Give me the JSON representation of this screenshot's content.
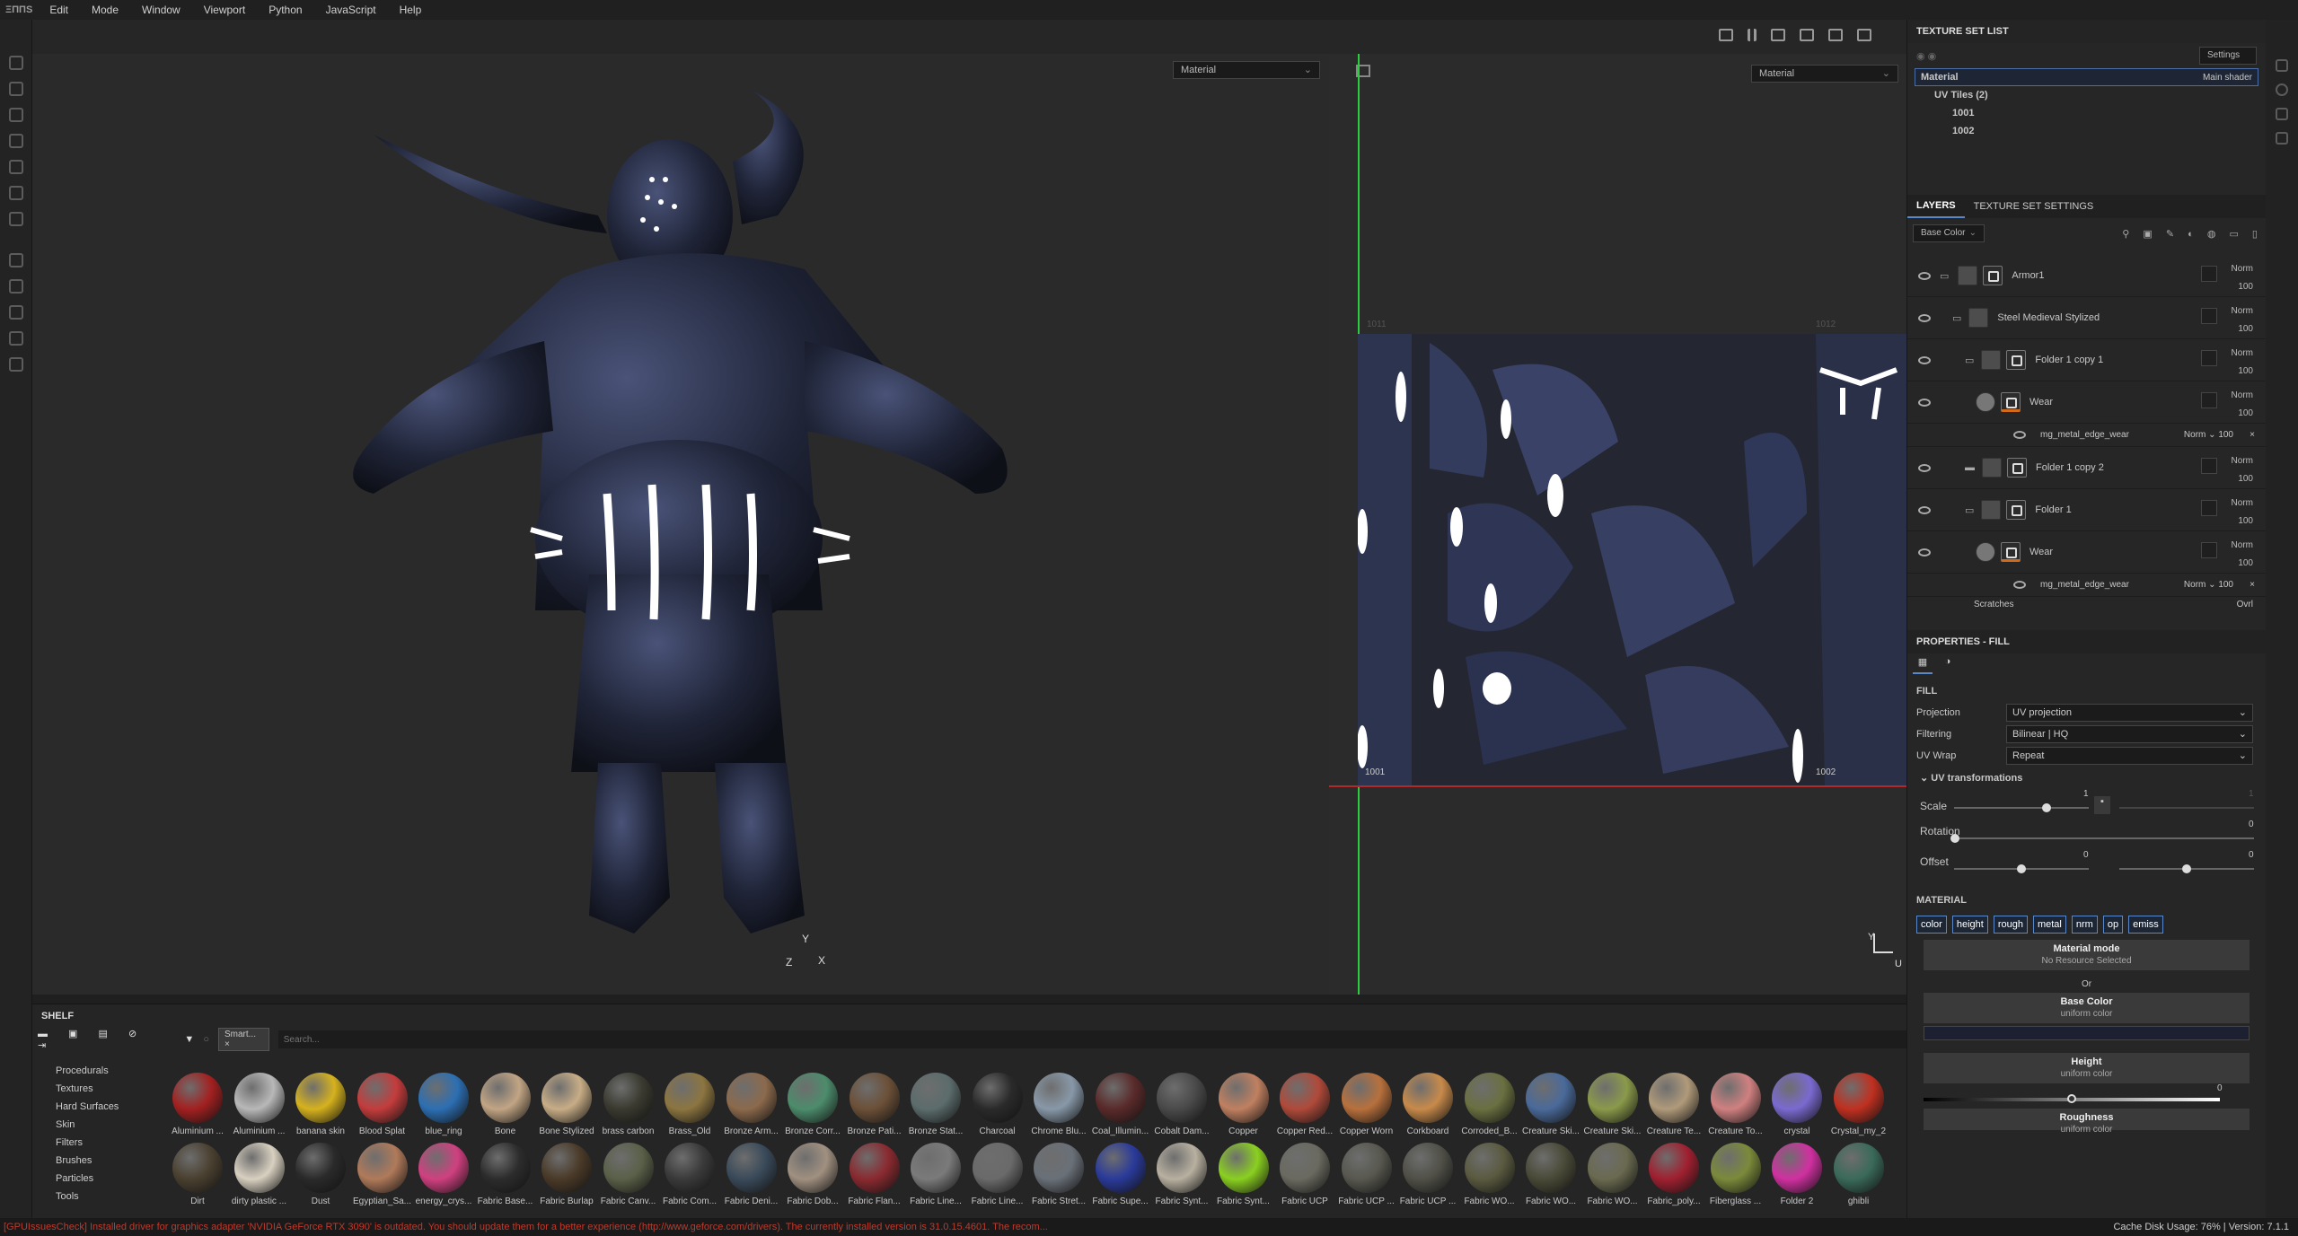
{
  "app": {
    "logo": "ΞΠΠS"
  },
  "menu": [
    "Edit",
    "Mode",
    "Window",
    "Viewport",
    "Python",
    "JavaScript",
    "Help"
  ],
  "viewport3d": {
    "channel": "Material",
    "axis_x": "X",
    "axis_y": "Y",
    "axis_z": "Z"
  },
  "viewport2d": {
    "channel": "Material",
    "tile_a": "1001",
    "tile_b": "1002",
    "axis_y": "Y",
    "axis_u": "U",
    "top_a": "1011",
    "top_b": "1012"
  },
  "texture_set_list": {
    "title": "TEXTURE SET LIST",
    "settings": "Settings",
    "material": "Material",
    "shader": "Main shader",
    "uv_tiles": "UV Tiles (2)",
    "tiles": [
      "1001",
      "1002"
    ]
  },
  "layers": {
    "tab_layers": "LAYERS",
    "tab_tss": "TEXTURE SET SETTINGS",
    "channel": "Base Color",
    "items": [
      {
        "name": "Armor1",
        "blend": "Norm",
        "opacity": "100",
        "type": "folder-open",
        "indent": 0
      },
      {
        "name": "Steel Medieval Stylized",
        "blend": "Norm",
        "opacity": "100",
        "type": "folder-open",
        "indent": 1
      },
      {
        "name": "Folder 1 copy 1",
        "blend": "Norm",
        "opacity": "100",
        "type": "folder-open",
        "indent": 2
      },
      {
        "name": "Wear",
        "blend": "Norm",
        "opacity": "100",
        "type": "fill",
        "indent": 3
      },
      {
        "name": "Folder 1 copy 2",
        "blend": "Norm",
        "opacity": "100",
        "type": "folder",
        "indent": 2
      },
      {
        "name": "Folder 1",
        "blend": "Norm",
        "opacity": "100",
        "type": "folder-open",
        "indent": 2
      },
      {
        "name": "Wear",
        "blend": "Norm",
        "opacity": "100",
        "type": "fill",
        "indent": 3
      }
    ],
    "sub_effect": "mg_metal_edge_wear",
    "sub_blend": "Norm",
    "sub_opacity": "100",
    "last_partial": "Scratches",
    "last_blend": "Ovrl"
  },
  "properties": {
    "title": "PROPERTIES - FILL",
    "section_fill": "FILL",
    "projection_label": "Projection",
    "projection": "UV projection",
    "filtering_label": "Filtering",
    "filtering": "Bilinear | HQ",
    "uvwrap_label": "UV Wrap",
    "uvwrap": "Repeat",
    "uvtrans": "UV transformations",
    "scale_label": "Scale",
    "scale_value": "1",
    "scale_value2": "1",
    "rotation_label": "Rotation",
    "rotation_value": "0",
    "offset_label": "Offset",
    "offset_a": "0",
    "offset_b": "0",
    "section_material": "MATERIAL",
    "channels": [
      "color",
      "height",
      "rough",
      "metal",
      "nrm",
      "op",
      "emiss"
    ],
    "material_mode": "Material mode",
    "no_resource": "No Resource Selected",
    "or": "Or",
    "base_color": "Base Color",
    "base_color_sub": "uniform color",
    "height": "Height",
    "height_sub": "uniform color",
    "height_value": "0",
    "roughness": "Roughness",
    "roughness_sub": "uniform color"
  },
  "shelf": {
    "title": "SHELF",
    "filter_tag": "Smart...",
    "search_placeholder": "Search...",
    "categories": [
      "Procedurals",
      "Textures",
      "Hard Surfaces",
      "Skin",
      "Filters",
      "Brushes",
      "Particles",
      "Tools"
    ],
    "row1": [
      {
        "name": "Aluminium ...",
        "color": "#a32020"
      },
      {
        "name": "Aluminium ...",
        "color": "#b8b8b8"
      },
      {
        "name": "banana skin",
        "color": "#d6b21e"
      },
      {
        "name": "Blood Splat",
        "color": "#c43c3c"
      },
      {
        "name": "blue_ring",
        "color": "#2c6fb3"
      },
      {
        "name": "Bone",
        "color": "#c2a584"
      },
      {
        "name": "Bone Stylized",
        "color": "#c8ad86"
      },
      {
        "name": "brass carbon",
        "color": "#3a3a30"
      },
      {
        "name": "Brass_Old",
        "color": "#8c7540"
      },
      {
        "name": "Bronze Arm...",
        "color": "#8c6a4c"
      },
      {
        "name": "Bronze Corr...",
        "color": "#4c8c6c"
      },
      {
        "name": "Bronze Pati...",
        "color": "#6c5038"
      },
      {
        "name": "Bronze Stat...",
        "color": "#5c6c6c"
      },
      {
        "name": "Charcoal",
        "color": "#2a2a2a"
      },
      {
        "name": "Chrome Blu...",
        "color": "#8898a8"
      },
      {
        "name": "Coal_Illumin...",
        "color": "#5a2a2a"
      },
      {
        "name": "Cobalt Dam...",
        "color": "#4a4a4a"
      },
      {
        "name": "Copper",
        "color": "#c08060"
      },
      {
        "name": "Copper Red...",
        "color": "#b04a3a"
      },
      {
        "name": "Copper Worn",
        "color": "#b8703c"
      },
      {
        "name": "Corkboard",
        "color": "#c88a4a"
      },
      {
        "name": "Corroded_B...",
        "color": "#6a7040"
      },
      {
        "name": "Creature Ski...",
        "color": "#4a6a9a"
      },
      {
        "name": "Creature Ski...",
        "color": "#8a9a4a"
      },
      {
        "name": "Creature Te...",
        "color": "#b09a7a"
      },
      {
        "name": "Creature To...",
        "color": "#d08080"
      },
      {
        "name": "crystal",
        "color": "#7a6ad0"
      },
      {
        "name": "Crystal_my_2",
        "color": "#c03020"
      }
    ],
    "row2": [
      {
        "name": "Dirt",
        "color": "#4a4030"
      },
      {
        "name": "dirty plastic ...",
        "color": "#d8d0c0"
      },
      {
        "name": "Dust",
        "color": "#2a2a2a"
      },
      {
        "name": "Egyptian_Sa...",
        "color": "#b07a5a"
      },
      {
        "name": "energy_crys...",
        "color": "#d04080"
      },
      {
        "name": "Fabric Base...",
        "color": "#2c2c2c"
      },
      {
        "name": "Fabric Burlap",
        "color": "#4a3a28"
      },
      {
        "name": "Fabric Canv...",
        "color": "#5a6048"
      },
      {
        "name": "Fabric Com...",
        "color": "#3a3a3a"
      },
      {
        "name": "Fabric Deni...",
        "color": "#3a4a5a"
      },
      {
        "name": "Fabric Dob...",
        "color": "#a09080"
      },
      {
        "name": "Fabric Flan...",
        "color": "#8a2a30"
      },
      {
        "name": "Fabric Line...",
        "color": "#7a7a7a"
      },
      {
        "name": "Fabric Line...",
        "color": "#6a6a6a"
      },
      {
        "name": "Fabric Stret...",
        "color": "#6a7078"
      },
      {
        "name": "Fabric Supe...",
        "color": "#2a3a9a"
      },
      {
        "name": "Fabric Synt...",
        "color": "#b8b0a0"
      },
      {
        "name": "Fabric Synt...",
        "color": "#8ad020"
      },
      {
        "name": "Fabric UCP",
        "color": "#6a6a60"
      },
      {
        "name": "Fabric UCP ...",
        "color": "#585850"
      },
      {
        "name": "Fabric UCP ...",
        "color": "#505048"
      },
      {
        "name": "Fabric WO...",
        "color": "#5a5a40"
      },
      {
        "name": "Fabric WO...",
        "color": "#4a4a38"
      },
      {
        "name": "Fabric WO...",
        "color": "#6a6a50"
      },
      {
        "name": "Fabric_poly...",
        "color": "#a02030"
      },
      {
        "name": "Fiberglass ...",
        "color": "#7a8a3a"
      },
      {
        "name": "Folder 2",
        "color": "#d030a0"
      },
      {
        "name": "ghibli",
        "color": "#3a6a5a"
      }
    ]
  },
  "status": {
    "error": "[GPUIssuesCheck] Installed driver for graphics adapter 'NVIDIA GeForce RTX 3090' is outdated. You should update them for a better experience (http://www.geforce.com/drivers). The currently installed version is 31.0.15.4601. The recom...",
    "cache": "Cache Disk Usage:",
    "cache_value": "76%",
    "version": "Version: 7.1.1"
  },
  "colors": {
    "accent": "#5a87c8",
    "error": "#c0392b",
    "armor": "#1c2030",
    "orange_tab": "#d26a1a"
  }
}
